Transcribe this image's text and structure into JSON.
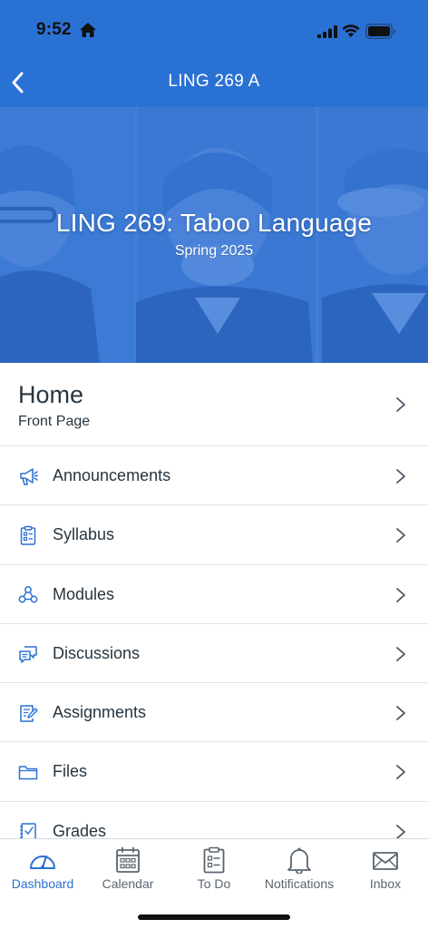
{
  "status_bar": {
    "time": "9:52"
  },
  "nav": {
    "title": "LING 269 A"
  },
  "hero": {
    "title": "LING 269: Taboo Language",
    "subtitle": "Spring 2025"
  },
  "home": {
    "title": "Home",
    "subtitle": "Front Page"
  },
  "menu": {
    "items": [
      {
        "label": "Announcements",
        "icon": "megaphone-icon"
      },
      {
        "label": "Syllabus",
        "icon": "syllabus-icon"
      },
      {
        "label": "Modules",
        "icon": "modules-icon"
      },
      {
        "label": "Discussions",
        "icon": "discussions-icon"
      },
      {
        "label": "Assignments",
        "icon": "assignments-icon"
      },
      {
        "label": "Files",
        "icon": "folder-icon"
      },
      {
        "label": "Grades",
        "icon": "grades-icon"
      }
    ]
  },
  "tabs": [
    {
      "label": "Dashboard",
      "icon": "dashboard-icon",
      "active": true
    },
    {
      "label": "Calendar",
      "icon": "calendar-icon",
      "active": false
    },
    {
      "label": "To Do",
      "icon": "todo-icon",
      "active": false
    },
    {
      "label": "Notifications",
      "icon": "bell-icon",
      "active": false
    },
    {
      "label": "Inbox",
      "icon": "envelope-icon",
      "active": false
    }
  ],
  "colors": {
    "brand": "#2a71d4",
    "text": "#273540",
    "divider": "#e2e4e6",
    "tab_inactive": "#5a6570"
  }
}
